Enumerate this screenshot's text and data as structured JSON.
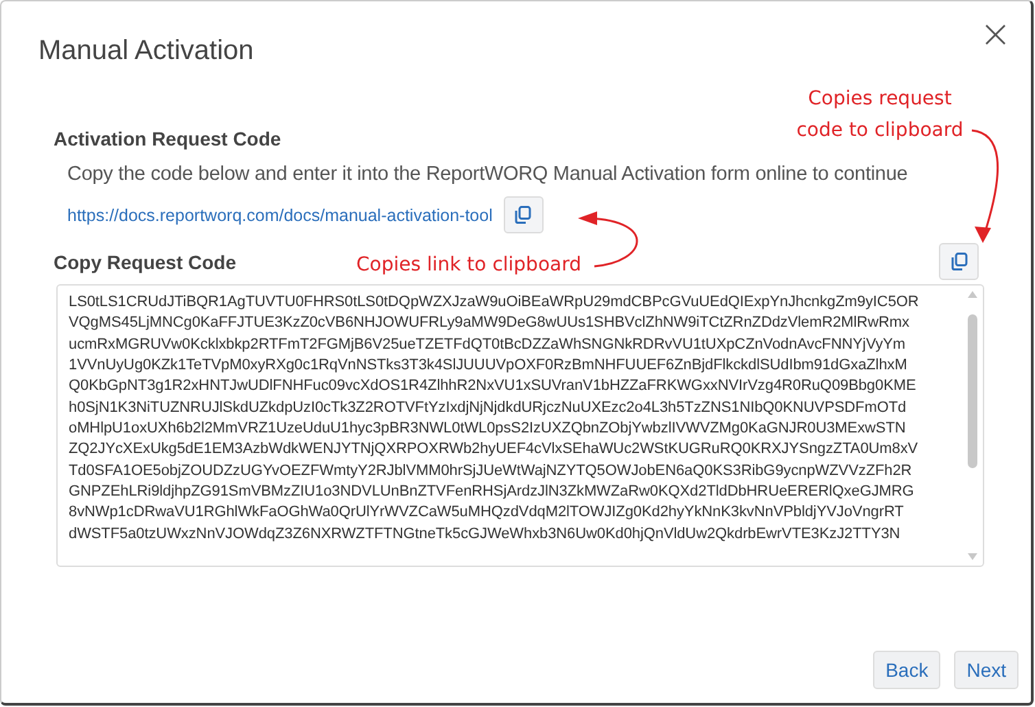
{
  "window": {
    "title": "Manual Activation",
    "close": "×"
  },
  "activation": {
    "heading": "Activation Request Code",
    "description": "Copy the code below and enter it into the ReportWORQ Manual Activation form online to continue",
    "link": "https://docs.reportworq.com/docs/manual-activation-tool"
  },
  "request_code": {
    "heading": "Copy Request Code",
    "lines": [
      "LS0tLS1CRUdJTiBQR1AgTUVTU0FHRS0tLS0tDQpWZXJzaW9uOiBEaWRpU29mdCBPcGVuUEdQIExpYnJhcnkgZm9yIC5OR",
      "VQgMS45LjMNCg0KaFFJTUE3KzZ0cVB6NHJOWUFRLy9aMW9DeG8wUUs1SHBVclZhNW9iTCtZRnZDdzVlemR2MlRwRmx",
      "ucmRxMGRUVw0Kcklxbkp2RTFmT2FGMjB6V25ueTZETFdQT0tBcDZZaWhSNGNkRDRvVU1tUXpCZnVodnAvcFNNYjVyYm",
      "1VVnUyUg0KZk1TeTVpM0xyRXg0c1RqVnNSTks3T3k4SlJUUUVpOXF0RzBmNHFUUEF6ZnBjdFlkckdlSUdIbm91dGxaZlhxM",
      "Q0KbGpNT3g1R2xHNTJwUDlFNHFuc09vcXdOS1R4ZlhhR2NxVU1xSUVranV1bHZZaFRKWGxxNVIrVzg4R0RuQ09Bbg0KME",
      "h0SjN1K3NiTUZNRUJlSkdUZkdpUzI0cTk3Z2ROTVFtYzIxdjNjNjdkdURjczNuUXEzc2o4L3h5TzZNS1NIbQ0KNUVPSDFmOTd",
      "oMHlpU1oxUXh6b2l2MmVRZ1UzeUduU1hyc3pBR3NWL0tWL0psS2IzUXZQbnZObjYwbzlIVWVZMg0KaGNJR0U3MExwSTN",
      "ZQ2JYcXExUkg5dE1EM3AzbWdkWENJYTNjQXRPOXRWb2hyUEF4cVlxSEhaWUc2WStKUGRuRQ0KRXJYSngzZTA0Um8xV",
      "Td0SFA1OE5objZOUDZzUGYvOEZFWmtyY2RJblVMM0hrSjJUeWtWajNZYTQ5OWJobEN6aQ0KS3RibG9ycnpWZVVzZFh2R",
      "GNPZEhLRi9ldjhpZG91SmVBMzZIU1o3NDVLUnBnZTVFenRHSjArdzJlN3ZkMWZaRw0KQXd2TldDbHRUeERERlQxeGJMRG",
      "8vNWp1cDRwaVU1RGhlWkFaOGhWa0QrUlYrWVZCaW5uMHQzdVdqM2lTOWJIZg0Kd2hyYkNnK3kvNnVPbldjYVJoVngrRT",
      "dWSTF5a0tzUWxzNnVJOWdqZ3Z6NXRWZTFTNGtneTk5cGJWeWhxb3N6Uw0Kd0hjQnVldUw2QkdrbEwrVTE3KzJ2TTY3N"
    ]
  },
  "annotations": [
    {
      "kind": "code",
      "text": "Copies request code to clipboard"
    },
    {
      "kind": "link",
      "text": "Copies link to clipboard"
    }
  ],
  "buttons": [
    {
      "label": "Back"
    },
    {
      "label": "Next"
    }
  ]
}
